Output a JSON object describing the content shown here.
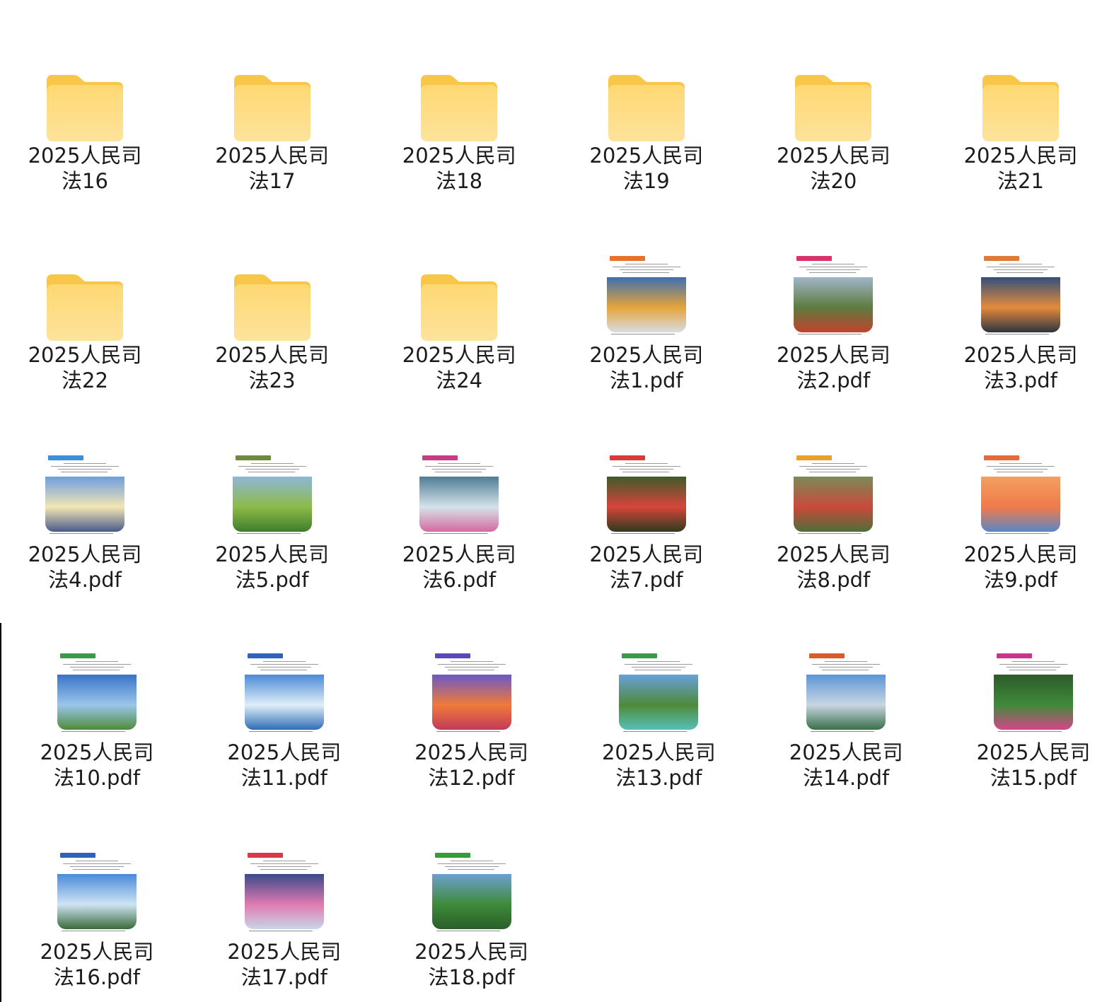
{
  "top_items": [
    {
      "type": "folder",
      "line1": "2025人民司",
      "line2": "法16"
    },
    {
      "type": "folder",
      "line1": "2025人民司",
      "line2": "法17"
    },
    {
      "type": "folder",
      "line1": "2025人民司",
      "line2": "法18"
    },
    {
      "type": "folder",
      "line1": "2025人民司",
      "line2": "法19"
    },
    {
      "type": "folder",
      "line1": "2025人民司",
      "line2": "法20"
    },
    {
      "type": "folder",
      "line1": "2025人民司",
      "line2": "法21"
    },
    {
      "type": "folder",
      "line1": "2025人民司",
      "line2": "法22"
    },
    {
      "type": "folder",
      "line1": "2025人民司",
      "line2": "法23"
    },
    {
      "type": "folder",
      "line1": "2025人民司",
      "line2": "法24"
    },
    {
      "type": "pdf",
      "line1": "2025人民司",
      "line2": "法1.pdf",
      "tab_color": "#e8722c",
      "photo": [
        "#3c6fb0",
        "#e6a43a",
        "#d8dde2"
      ]
    },
    {
      "type": "pdf",
      "line1": "2025人民司",
      "line2": "法2.pdf",
      "tab_color": "#d9336e",
      "photo": [
        "#9fb6c8",
        "#5e7b3f",
        "#c2422e"
      ]
    },
    {
      "type": "pdf",
      "line1": "2025人民司",
      "line2": "法3.pdf",
      "tab_color": "#e07a38",
      "photo": [
        "#33507a",
        "#e58a3c",
        "#2d3440"
      ]
    },
    {
      "type": "pdf",
      "line1": "2025人民司",
      "line2": "法4.pdf",
      "tab_color": "#3d8fdb",
      "photo": [
        "#6d9ee0",
        "#f3e6b5",
        "#4a5a8a"
      ]
    },
    {
      "type": "pdf",
      "line1": "2025人民司",
      "line2": "法5.pdf",
      "tab_color": "#6f8a3a",
      "photo": [
        "#8fb6d8",
        "#8dbb48",
        "#3f7d2c"
      ]
    },
    {
      "type": "pdf",
      "line1": "2025人民司",
      "line2": "法6.pdf",
      "tab_color": "#c73d84",
      "photo": [
        "#4f7c95",
        "#d5e3ea",
        "#d46aa0"
      ]
    },
    {
      "type": "pdf",
      "line1": "2025人民司",
      "line2": "法7.pdf",
      "tab_color": "#d93a3a",
      "photo": [
        "#3f5a2a",
        "#d7453b",
        "#2d3b1e"
      ]
    },
    {
      "type": "pdf",
      "line1": "2025人民司",
      "line2": "法8.pdf",
      "tab_color": "#e8a22a",
      "photo": [
        "#7c8a5a",
        "#c94a3a",
        "#4e6e3a"
      ]
    },
    {
      "type": "pdf",
      "line1": "2025人民司",
      "line2": "法9.pdf",
      "tab_color": "#e86a3a",
      "photo": [
        "#f2a061",
        "#f07a4a",
        "#5a86c8"
      ]
    }
  ],
  "bottom_items": [
    {
      "type": "pdf",
      "line1": "2025人民司",
      "line2": "法10.pdf",
      "tab_color": "#3a9a4a",
      "photo": [
        "#3a72c8",
        "#9ac7ea",
        "#4f8a3a"
      ]
    },
    {
      "type": "pdf",
      "line1": "2025人民司",
      "line2": "法11.pdf",
      "tab_color": "#2f62b8",
      "photo": [
        "#4b8ad6",
        "#dfeef8",
        "#2f6db5"
      ]
    },
    {
      "type": "pdf",
      "line1": "2025人民司",
      "line2": "法12.pdf",
      "tab_color": "#5a4ab8",
      "photo": [
        "#6b58c8",
        "#f07a3a",
        "#c23a5a"
      ]
    },
    {
      "type": "pdf",
      "line1": "2025人民司",
      "line2": "法13.pdf",
      "tab_color": "#3a9a4a",
      "photo": [
        "#6aa0d8",
        "#4d8a3a",
        "#58c0b8"
      ]
    },
    {
      "type": "pdf",
      "line1": "2025人民司",
      "line2": "法14.pdf",
      "tab_color": "#d95a2a",
      "photo": [
        "#5b95d8",
        "#c8d6e2",
        "#3a6e4a"
      ]
    },
    {
      "type": "pdf",
      "line1": "2025人民司",
      "line2": "法15.pdf",
      "tab_color": "#c7368c",
      "photo": [
        "#2e5a2a",
        "#3f8a3a",
        "#d5468a"
      ]
    },
    {
      "type": "pdf",
      "line1": "2025人民司",
      "line2": "法16.pdf",
      "tab_color": "#2f62b8",
      "photo": [
        "#4a8ad8",
        "#cfe4f5",
        "#3a6a3a"
      ]
    },
    {
      "type": "pdf",
      "line1": "2025人民司",
      "line2": "法17.pdf",
      "tab_color": "#d93a4a",
      "photo": [
        "#3a4a8a",
        "#e07ab0",
        "#c8d6ea"
      ]
    },
    {
      "type": "pdf",
      "line1": "2025人民司",
      "line2": "法18.pdf",
      "tab_color": "#3a9a3a",
      "photo": [
        "#6ea0d0",
        "#3f8a3a",
        "#2a5e2a"
      ]
    }
  ],
  "folder_colors": {
    "back": "#f8c74a",
    "front_top": "#fed872",
    "front_bottom": "#fde39c"
  }
}
